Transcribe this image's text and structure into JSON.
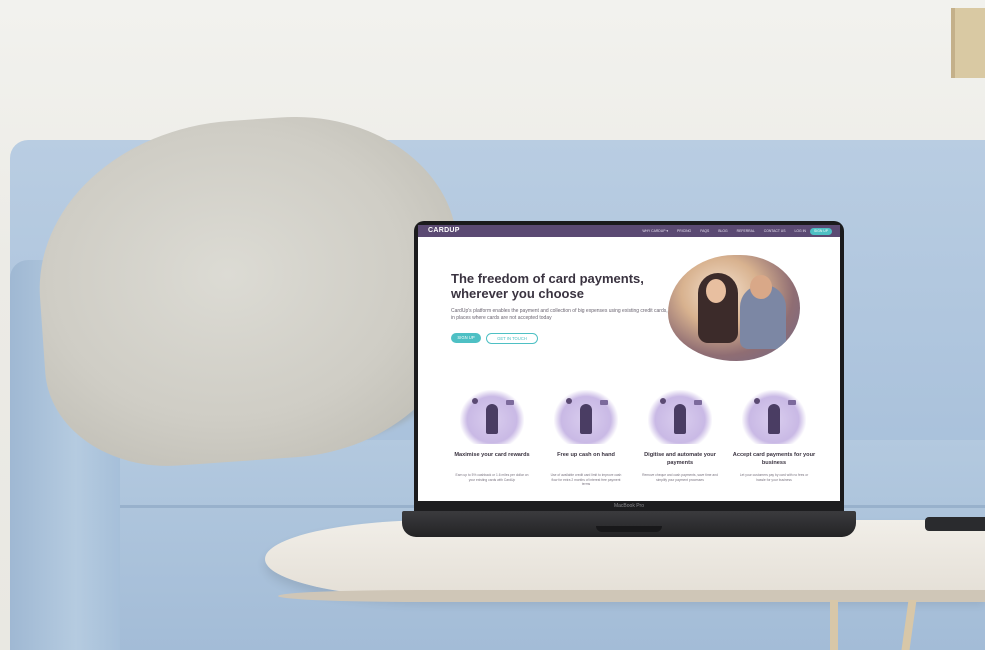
{
  "website": {
    "logo": "CARDUP",
    "nav": [
      "WHY CARDUP ▾",
      "PRICING",
      "FAQS",
      "BLOG",
      "REFERRAL",
      "CONTACT US",
      "LOG IN"
    ],
    "nav_signup": "SIGN UP",
    "hero": {
      "title": "The freedom of card payments, wherever you choose",
      "description": "CardUp's platform enables the payment and collection of big expenses using existing credit cards, in places where cards are not accepted today",
      "signup_button": "SIGN UP",
      "contact_button": "GET IN TOUCH"
    },
    "features": [
      {
        "title": "Maximise your card rewards",
        "description": "Earn up to 5% cashback or 1.6 miles per dollar on your existing cards with CardUp"
      },
      {
        "title": "Free up cash on hand",
        "description": "Use of available credit card limit to improve cash flow for extra 2 months of interest free payment terms"
      },
      {
        "title": "Digitise and automate your payments",
        "description": "Remove cheque and cash payments, save time and simplify your payment processes"
      },
      {
        "title": "Accept card payments for your business",
        "description": "Let your customers pay by card with no fees or hassle for your business"
      }
    ]
  },
  "laptop_label": "MacBook Pro",
  "colors": {
    "brand_purple": "#5b4a73",
    "accent_teal": "#4ec0c4",
    "sofa_blue": "#a9c1db"
  }
}
